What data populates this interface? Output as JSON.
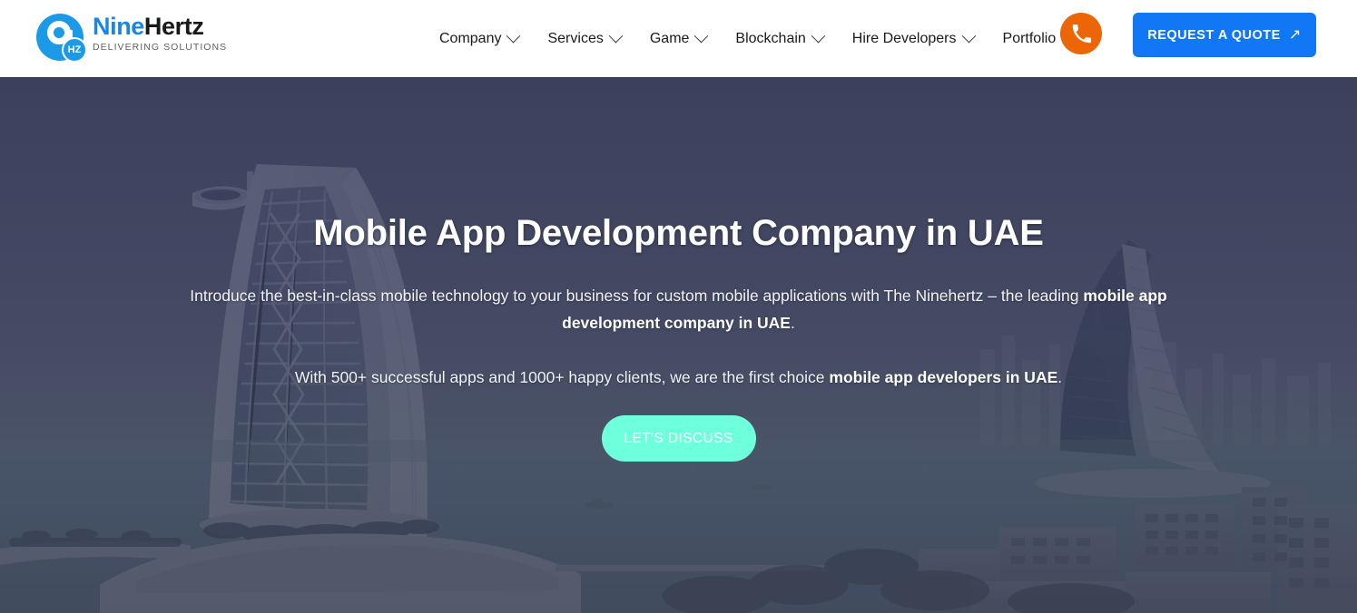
{
  "header": {
    "logo": {
      "mark_icon": "ninehertz-logo-icon",
      "badge_text": "HZ",
      "word_primary": "Nine",
      "word_secondary": "Hertz",
      "tagline": "DELIVERING SOLUTIONS"
    },
    "nav_items": [
      {
        "label": "Company",
        "has_dropdown": true
      },
      {
        "label": "Services",
        "has_dropdown": true
      },
      {
        "label": "Game",
        "has_dropdown": true
      },
      {
        "label": "Blockchain",
        "has_dropdown": true
      },
      {
        "label": "Hire Developers",
        "has_dropdown": true
      },
      {
        "label": "Portfolio",
        "has_dropdown": false
      }
    ],
    "phone_icon": "phone-icon",
    "quote_button": {
      "label": "REQUEST A QUOTE",
      "arrow": "↗"
    }
  },
  "hero": {
    "title": "Mobile App Development Company in UAE",
    "paragraph1": {
      "before": "Introduce the best-in-class mobile technology to your business for custom mobile applications with The Ninehertz – the leading ",
      "bold": "mobile app development company in UAE",
      "after": "."
    },
    "paragraph2": {
      "before": "With 500+ successful apps and 1000+ happy clients, we are the first choice ",
      "bold": "mobile app developers in UAE",
      "after": "."
    },
    "cta_label": "LET'S DISCUSS",
    "background_image": "burj-al-arab-dubai-skyline-photo"
  },
  "colors": {
    "brand_blue": "#1b86e0",
    "logo_mark_blue": "#1b9ae8",
    "quote_button_blue": "#1177f5",
    "phone_orange": "#ec6608",
    "cta_mint": "#6effdc",
    "hero_overlay_navy": "#3b3f5c",
    "header_white": "#ffffff"
  }
}
